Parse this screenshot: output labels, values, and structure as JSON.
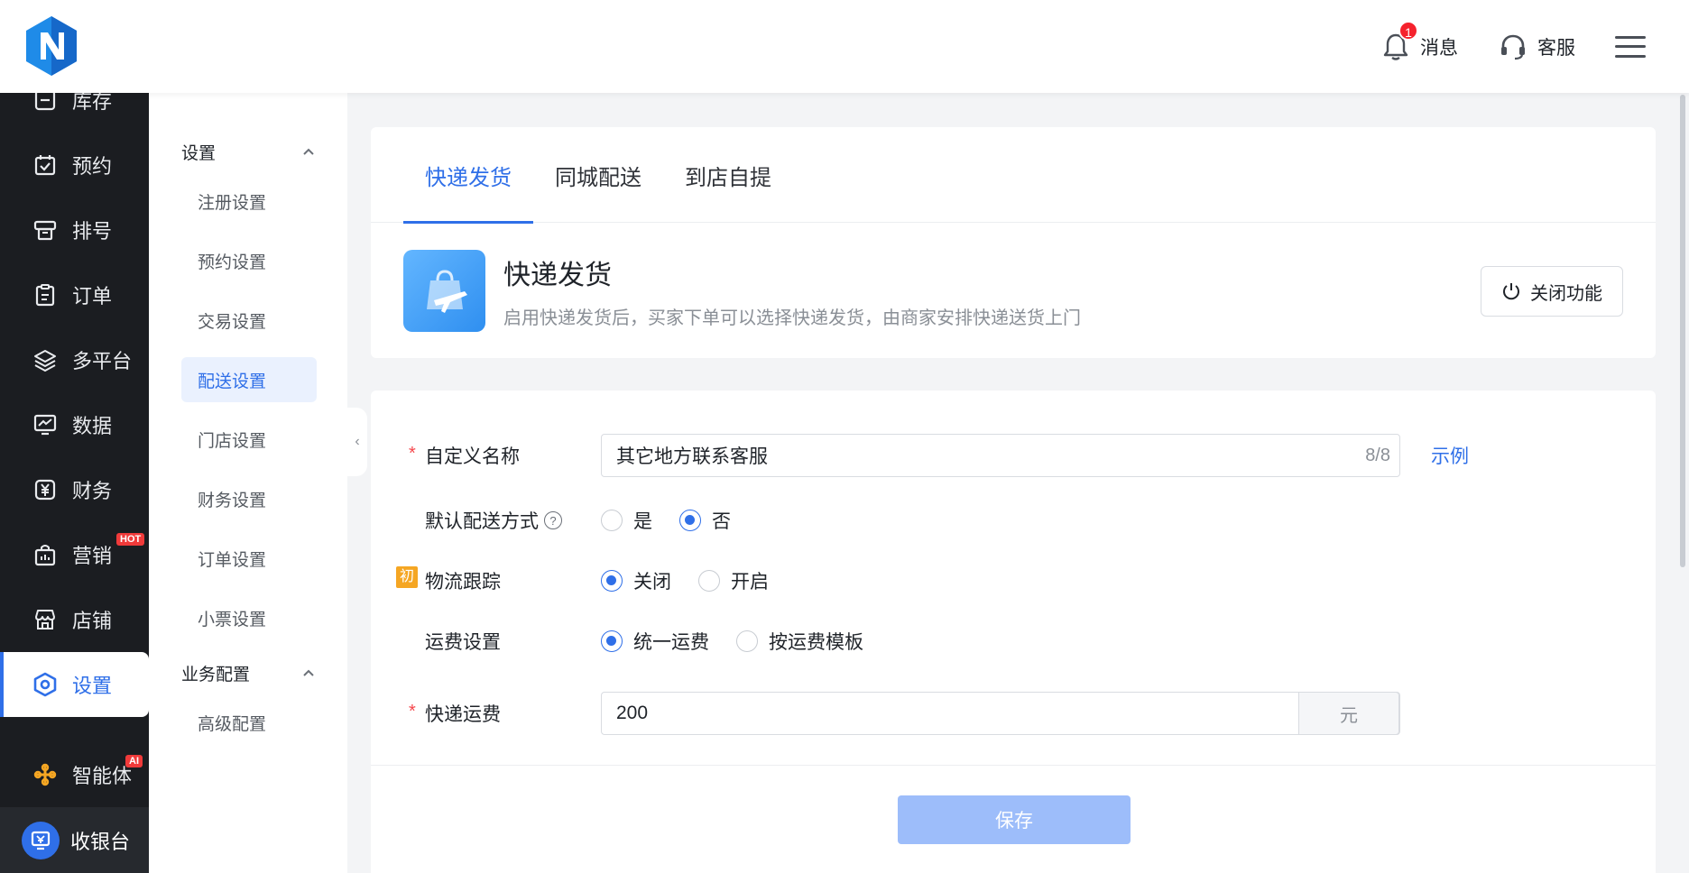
{
  "header": {
    "messages_label": "消息",
    "messages_badge": "1",
    "service_label": "客服"
  },
  "sidebar": {
    "items": [
      {
        "label": "库存",
        "icon": "inventory-icon"
      },
      {
        "label": "预约",
        "icon": "calendar-check-icon"
      },
      {
        "label": "排号",
        "icon": "queue-icon"
      },
      {
        "label": "订单",
        "icon": "clipboard-icon"
      },
      {
        "label": "多平台",
        "icon": "layers-icon"
      },
      {
        "label": "数据",
        "icon": "chart-icon"
      },
      {
        "label": "财务",
        "icon": "yen-icon"
      },
      {
        "label": "营销",
        "icon": "marketing-icon",
        "tag": "HOT"
      },
      {
        "label": "店铺",
        "icon": "store-icon"
      },
      {
        "label": "设置",
        "icon": "settings-icon",
        "active": true
      }
    ],
    "agent": {
      "label": "智能体",
      "tag": "AI"
    },
    "cashier": {
      "label": "收银台"
    }
  },
  "subnav": {
    "group1": "设置",
    "items": [
      "注册设置",
      "预约设置",
      "交易设置",
      "配送设置",
      "门店设置",
      "财务设置",
      "订单设置",
      "小票设置"
    ],
    "active_index": 3,
    "group2": "业务配置",
    "group2_items": [
      "高级配置"
    ]
  },
  "tabs": [
    "快递发货",
    "同城配送",
    "到店自提"
  ],
  "feature": {
    "title": "快递发货",
    "description": "启用快递发货后，买家下单可以选择快递发货，由商家安排快递送货上门",
    "close_button": "关闭功能"
  },
  "form": {
    "custom_name": {
      "label": "自定义名称",
      "value": "其它地方联系客服",
      "counter": "8/8",
      "example": "示例"
    },
    "default_delivery": {
      "label": "默认配送方式",
      "help": "?",
      "options": [
        "是",
        "否"
      ],
      "selected": "否"
    },
    "logistics": {
      "badge": "初",
      "label": "物流跟踪",
      "options": [
        "关闭",
        "开启"
      ],
      "selected": "关闭"
    },
    "freight_setting": {
      "label": "运费设置",
      "options": [
        "统一运费",
        "按运费模板"
      ],
      "selected": "统一运费"
    },
    "express_fee": {
      "label": "快递运费",
      "value": "200",
      "unit": "元"
    },
    "save_button": "保存"
  },
  "colors": {
    "accent": "#2f6fe8",
    "sidebar_bg": "#1b1d21",
    "hot": "#f03a3a",
    "save_disabled": "#9dbdfa"
  }
}
